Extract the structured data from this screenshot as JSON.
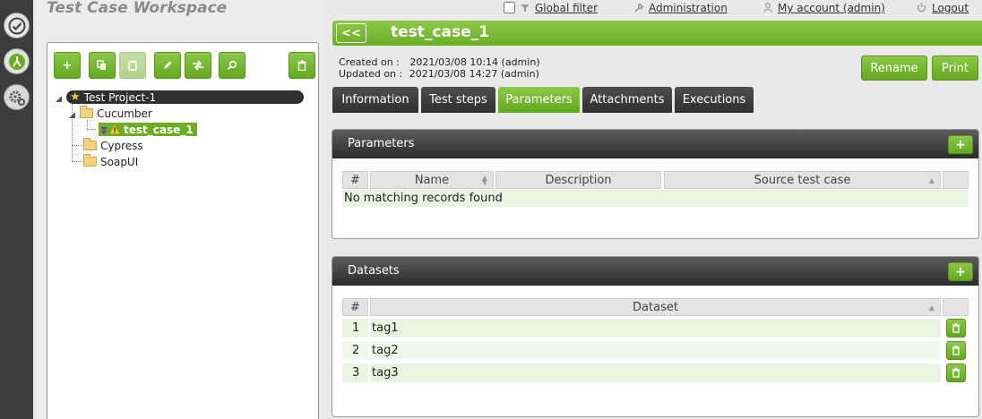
{
  "workspace": {
    "title": "Test Case Workspace"
  },
  "tree": {
    "project": "Test Project-1",
    "folders": [
      {
        "label": "Cucumber",
        "children": [
          {
            "label": "test_case_1",
            "selected": true
          }
        ]
      },
      {
        "label": "Cypress"
      },
      {
        "label": "SoapUI"
      }
    ]
  },
  "topbar": {
    "global_filter": "Global filter",
    "administration": "Administration",
    "my_account": "My account (admin)",
    "logout": "Logout"
  },
  "test_case": {
    "back_label": "<<",
    "name": "test_case_1",
    "created_label": "Created on :",
    "created_value": "2021/03/08 10:14 (admin)",
    "updated_label": "Updated on :",
    "updated_value": "2021/03/08 14:27 (admin)",
    "rename_label": "Rename",
    "print_label": "Print"
  },
  "tabs": [
    {
      "label": "Information",
      "active": false
    },
    {
      "label": "Test steps",
      "active": false
    },
    {
      "label": "Parameters",
      "active": true
    },
    {
      "label": "Attachments",
      "active": false
    },
    {
      "label": "Executions",
      "active": false
    }
  ],
  "parameters": {
    "title": "Parameters",
    "add_label": "+",
    "columns": [
      "#",
      "Name",
      "Description",
      "Source test case"
    ],
    "empty_text": "No matching records found"
  },
  "datasets": {
    "title": "Datasets",
    "add_label": "+",
    "columns": [
      "#",
      "Dataset"
    ],
    "rows": [
      {
        "num": "1",
        "name": "tag1"
      },
      {
        "num": "2",
        "name": "tag2"
      },
      {
        "num": "3",
        "name": "tag3"
      }
    ]
  },
  "colors": {
    "accent_green": "#6bae23",
    "dark_header": "#2c2c2c",
    "row_highlight": "#eaf3df"
  }
}
